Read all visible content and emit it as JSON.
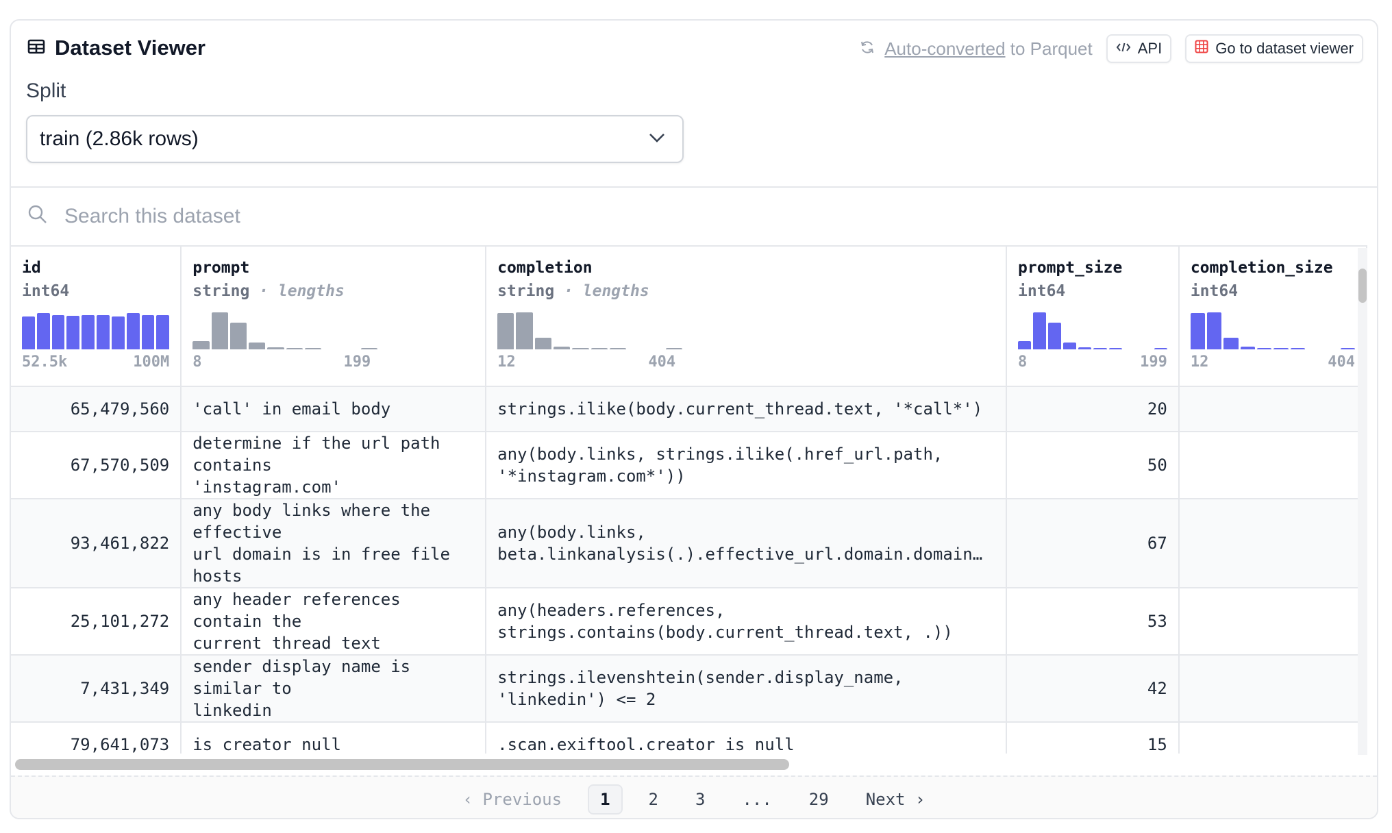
{
  "header": {
    "title": "Dataset Viewer",
    "converted_link": "Auto-converted",
    "converted_rest": " to Parquet",
    "api_label": "API",
    "viewer_label": "Go to dataset viewer"
  },
  "split": {
    "label": "Split",
    "selected": "train (2.86k rows)"
  },
  "search": {
    "placeholder": "Search this dataset"
  },
  "columns": [
    {
      "name": "id",
      "type": "int64",
      "type_note": "",
      "range_min": "52.5k",
      "range_max": "100M",
      "hist_color": "blue",
      "hist": [
        0.88,
        0.98,
        0.93,
        0.9,
        0.93,
        0.93,
        0.88,
        0.98,
        0.93,
        0.93
      ]
    },
    {
      "name": "prompt",
      "type": "string",
      "type_note": " · lengths",
      "range_min": "8",
      "range_max": "199",
      "hist_color": "gray",
      "hist": [
        0.22,
        1.0,
        0.72,
        0.18,
        0.06,
        0.04,
        0.03,
        0.0,
        0.0,
        0.04
      ]
    },
    {
      "name": "completion",
      "type": "string",
      "type_note": " · lengths",
      "range_min": "12",
      "range_max": "404",
      "hist_color": "gray",
      "hist": [
        0.98,
        1.0,
        0.32,
        0.08,
        0.04,
        0.03,
        0.03,
        0.0,
        0.0,
        0.03
      ]
    },
    {
      "name": "prompt_size",
      "type": "int64",
      "type_note": "",
      "range_min": "8",
      "range_max": "199",
      "hist_color": "blue",
      "hist": [
        0.22,
        1.0,
        0.72,
        0.18,
        0.06,
        0.04,
        0.03,
        0.0,
        0.0,
        0.04
      ]
    },
    {
      "name": "completion_size",
      "type": "int64",
      "type_note": "",
      "range_min": "12",
      "range_max": "404",
      "hist_color": "blue",
      "hist": [
        0.98,
        1.0,
        0.32,
        0.08,
        0.04,
        0.03,
        0.03,
        0.0,
        0.0,
        0.03
      ]
    }
  ],
  "rows": [
    {
      "id": "65,479,560",
      "prompt": "'call' in email body",
      "completion": "strings.ilike(body.current_thread.text, '*call*')",
      "prompt_size": "20"
    },
    {
      "id": "67,570,509",
      "prompt": "determine if the url path contains\n'instagram.com'",
      "completion": "any(body.links, strings.ilike(.href_url.path,\n'*instagram.com*'))",
      "prompt_size": "50"
    },
    {
      "id": "93,461,822",
      "prompt": "any body links where the effective\nurl domain is in free file hosts",
      "completion": "any(body.links,\nbeta.linkanalysis(.).effective_url.domain.domain…",
      "prompt_size": "67"
    },
    {
      "id": "25,101,272",
      "prompt": "any header references contain the\ncurrent thread text",
      "completion": "any(headers.references,\nstrings.contains(body.current_thread.text, .))",
      "prompt_size": "53"
    },
    {
      "id": "7,431,349",
      "prompt": "sender display name is similar to\nlinkedin",
      "completion": "strings.ilevenshtein(sender.display_name,\n'linkedin') <= 2",
      "prompt_size": "42"
    },
    {
      "id": "79,641,073",
      "prompt": "is creator null",
      "completion": ".scan.exiftool.creator is null",
      "prompt_size": "15"
    }
  ],
  "pagination": {
    "prev": "Previous",
    "pages": [
      "1",
      "2",
      "3",
      "...",
      "29"
    ],
    "next": "Next"
  },
  "colors": {
    "histogram_blue": "#6366f1",
    "histogram_gray": "#9ca3af",
    "border": "#e5e7eb"
  }
}
